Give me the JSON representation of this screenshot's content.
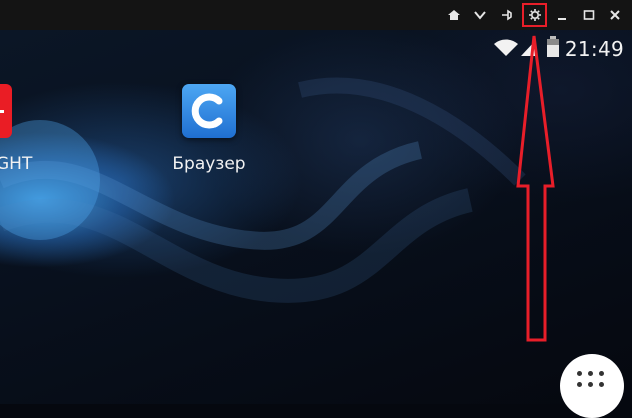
{
  "window": {
    "controls": {
      "home_icon": "home-icon",
      "dropdown_icon": "chevron-down-icon",
      "pin_icon": "pin-icon",
      "settings_icon": "gear-icon",
      "minimize_icon": "minimize-icon",
      "maximize_icon": "maximize-icon",
      "close_icon": "close-icon"
    }
  },
  "status_bar": {
    "time": "21:49"
  },
  "home_screen": {
    "apps": [
      {
        "label": "GHT",
        "icon": "app-icon-partial-red"
      },
      {
        "label": "Браузер",
        "icon": "browser-icon"
      }
    ]
  },
  "colors": {
    "annotation": "#e81e29",
    "titlebar": "#141414"
  }
}
